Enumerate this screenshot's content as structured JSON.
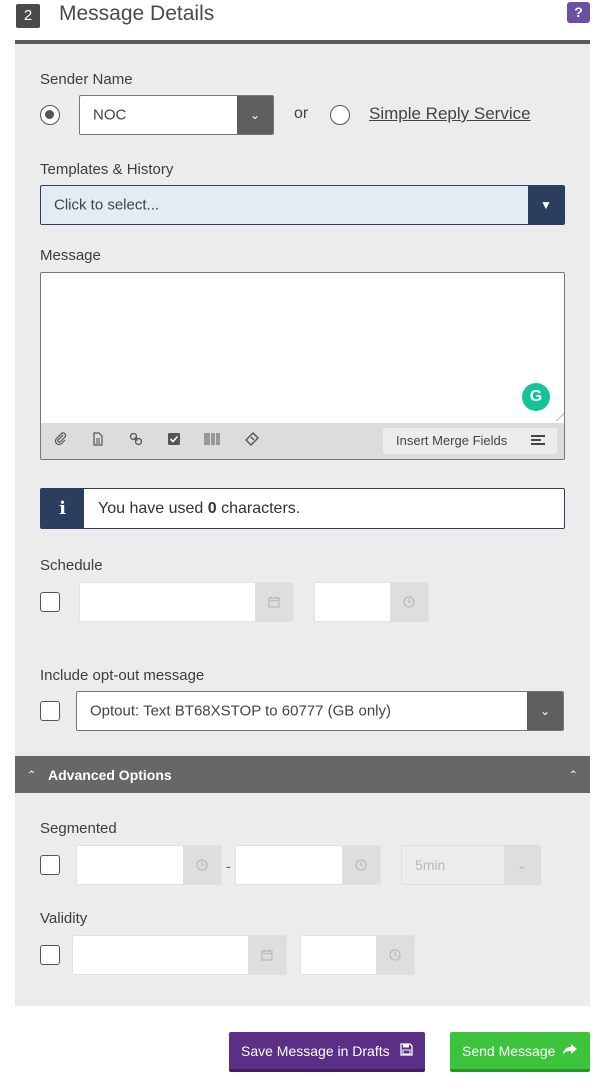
{
  "header": {
    "step_number": "2",
    "title": "Message Details",
    "help_symbol": "?"
  },
  "sender": {
    "label": "Sender Name",
    "selected_value": "NOC",
    "or_text": "or",
    "alt_option": "Simple Reply Service"
  },
  "templates": {
    "label": "Templates & History",
    "placeholder": "Click to select..."
  },
  "message": {
    "label": "Message",
    "value": "",
    "toolbar_icons": [
      "paperclip-icon",
      "document-icon",
      "link-icon",
      "checkbox-icon",
      "barcode-icon",
      "ticket-icon"
    ],
    "merge_fields_label": "Insert Merge Fields",
    "grammarly_letter": "G"
  },
  "char_count": {
    "prefix": "You have used ",
    "count": "0",
    "suffix": " characters."
  },
  "schedule": {
    "label": "Schedule",
    "date_value": "",
    "time_value": ""
  },
  "optout": {
    "label": "Include opt-out message",
    "selected_value": "Optout: Text BT68XSTOP to 60777 (GB only)"
  },
  "advanced": {
    "title": "Advanced Options",
    "segmented_label": "Segmented",
    "segment_separator": "-",
    "segment_interval": "5min",
    "validity_label": "Validity"
  },
  "actions": {
    "save_label": "Save Message in Drafts",
    "send_label": "Send Message"
  },
  "colors": {
    "navy": "#2c3e5e",
    "purple": "#5b2f86",
    "green": "#3cc43c",
    "help": "#6b4fa1"
  }
}
